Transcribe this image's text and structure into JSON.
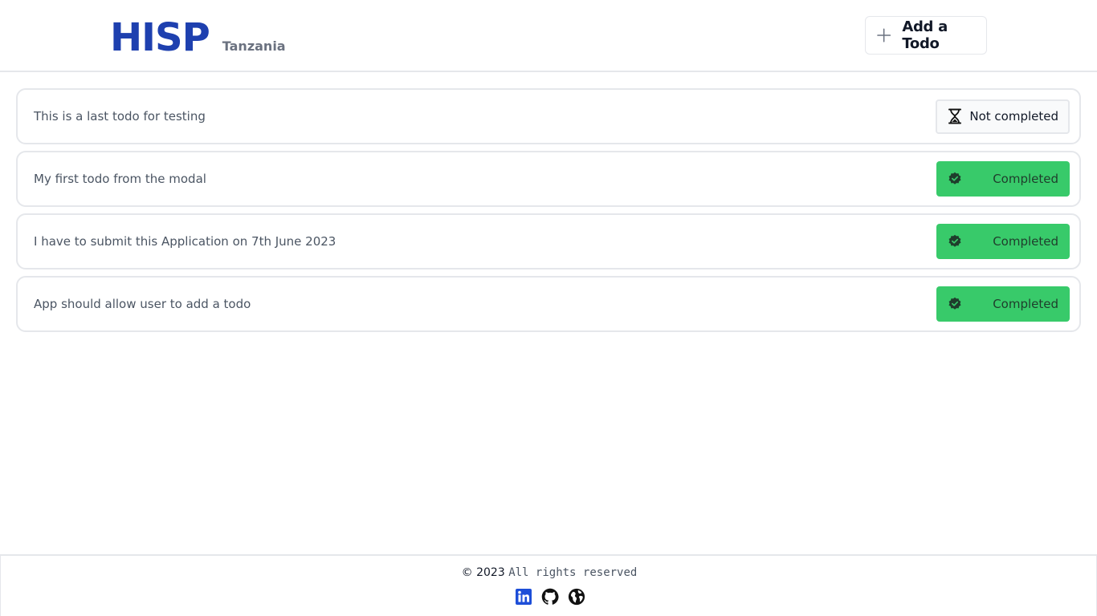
{
  "header": {
    "brand_name": "HISP",
    "brand_sub": "Tanzania",
    "add_button_label": "Add a Todo",
    "add_button_icon": "plus-icon"
  },
  "todos": [
    {
      "text": "This is a last todo for testing",
      "status": "Not completed",
      "icon": "hourglass-icon"
    },
    {
      "text": "My first todo from the modal",
      "status": "Completed",
      "icon": "verified-check-icon"
    },
    {
      "text": "I have to submit this Application on 7th June 2023",
      "status": "Completed",
      "icon": "verified-check-icon"
    },
    {
      "text": "App should allow user to add a todo",
      "status": "Completed",
      "icon": "verified-check-icon"
    }
  ],
  "footer": {
    "copyright": "© 2023",
    "rights": "All rights reserved",
    "socials": [
      "linkedin-icon",
      "github-icon",
      "globe-icon"
    ]
  },
  "colors": {
    "brand": "#1e40af",
    "completed": "#38ca6a",
    "border": "#e5e7eb"
  }
}
